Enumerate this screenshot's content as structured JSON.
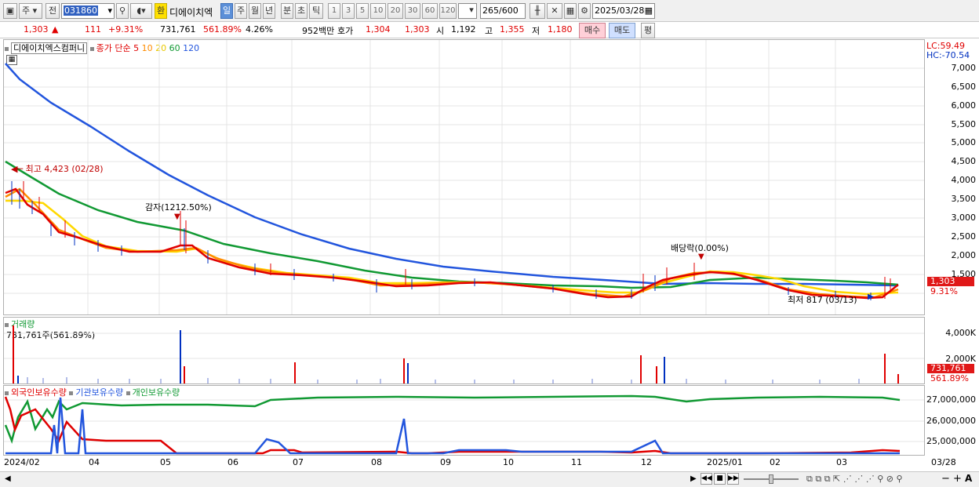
{
  "toolbar": {
    "type_label": "주",
    "prev_label": "전",
    "code": "031860",
    "stock_name": "디에이치엑",
    "hwan": "환",
    "periods": [
      "일",
      "주",
      "월",
      "년",
      "분",
      "초",
      "틱"
    ],
    "intervals": [
      "1",
      "3",
      "5",
      "10",
      "20",
      "30",
      "60",
      "120"
    ],
    "count": "265",
    "count_total": "/600",
    "date": "2025/03/28"
  },
  "quote": {
    "price": "1,303",
    "change": "111",
    "change_pct": "+9.31%",
    "volume": "731,761",
    "volume_pct": "561.89%",
    "turnover": "4.26%",
    "amount": "952백만",
    "bid_label": "호가",
    "bid1": "1,304",
    "bid2": "1,303",
    "open_label": "시",
    "open": "1,192",
    "high_label": "고",
    "high": "1,355",
    "low_label": "저",
    "low": "1,180",
    "buy": "매수",
    "sell": "매도",
    "avg": "평"
  },
  "price_panel": {
    "title": "디에이치엑스컴퍼니",
    "ma_label": "종가 단순",
    "ma_periods": [
      "5",
      "10",
      "20",
      "60",
      "120"
    ],
    "lc": "LC:59.49",
    "hc": "HC:-70.54",
    "y_ticks": [
      "7,000",
      "6,500",
      "6,000",
      "5,500",
      "5,000",
      "4,500",
      "4,000",
      "3,500",
      "3,000",
      "2,500",
      "2,000",
      "1,500"
    ],
    "price_box": "1,303",
    "pct_box": "9.31%",
    "ann_high": "최고 4,423 (02/28)",
    "ann_reduction": "감자(1212.50%)",
    "ann_dividend": "배당락(0.00%)",
    "ann_low": "최저 817 (03/13)"
  },
  "volume_panel": {
    "title": "거래량",
    "value": "731,761주(561.89%)",
    "y_ticks": [
      "4,000K",
      "2,000K"
    ],
    "box1": "731,761",
    "box2": "561.89%"
  },
  "holding_panel": {
    "legend": [
      "외국인보유수량",
      "기관보유수량",
      "개인보유수량"
    ],
    "y_ticks": [
      "27,000,000",
      "26,000,000",
      "25,000,000"
    ]
  },
  "x_labels": [
    "2024/02",
    "04",
    "05",
    "06",
    "07",
    "08",
    "09",
    "10",
    "11",
    "12",
    "2025/01",
    "02",
    "03"
  ],
  "x_right": "03/28",
  "colors": {
    "up": "#e00000",
    "down": "#0030c0",
    "ma5": "#e00000",
    "ma10": "#ff8c00",
    "ma20": "#ffd800",
    "ma60": "#119933",
    "ma120": "#2255dd"
  },
  "chart_data": {
    "type": "line",
    "title": "디에이치엑스컴퍼니",
    "x": [
      "2024/02",
      "04",
      "05",
      "06",
      "07",
      "08",
      "09",
      "10",
      "11",
      "12",
      "2025/01",
      "02",
      "03",
      "03/28"
    ],
    "series": [
      {
        "name": "120",
        "values": [
          7200,
          5300,
          3700,
          3100,
          2500,
          2000,
          1700,
          1500,
          1380,
          1280,
          1230,
          1240,
          1220,
          1210
        ]
      },
      {
        "name": "60",
        "values": [
          4500,
          3500,
          2900,
          2200,
          1900,
          1650,
          1450,
          1350,
          1320,
          1320,
          1350,
          1350,
          1310,
          1280
        ]
      },
      {
        "name": "20",
        "values": [
          3500,
          2700,
          2100,
          1800,
          1600,
          1450,
          1300,
          1250,
          1150,
          1250,
          1600,
          1400,
          1000,
          1080
        ]
      },
      {
        "name": "10",
        "values": [
          3700,
          2500,
          2200,
          1700,
          1550,
          1380,
          1270,
          1200,
          1050,
          1400,
          1600,
          1300,
          950,
          1150
        ]
      },
      {
        "name": "5",
        "values": [
          3800,
          2400,
          2300,
          1650,
          1550,
          1350,
          1250,
          1180,
          1000,
          1450,
          1620,
          1250,
          930,
          1250
        ]
      }
    ],
    "ylim": [
      817,
      7200
    ]
  }
}
